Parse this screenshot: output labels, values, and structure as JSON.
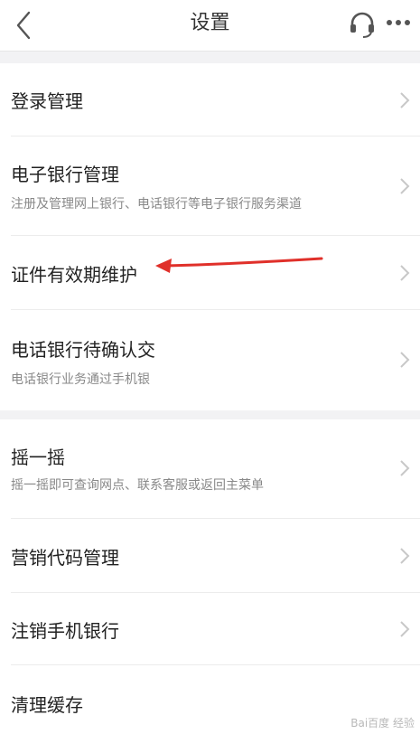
{
  "header": {
    "title": "设置",
    "back_icon": "chevron-left-icon",
    "headset_icon": "headset-icon",
    "more_icon": "more-dots-icon"
  },
  "menu": {
    "login": {
      "title": "登录管理"
    },
    "ebank": {
      "title": "电子银行管理",
      "subtitle": "注册及管理网上银行、电话银行等电子银行服务渠道"
    },
    "cert": {
      "title": "证件有效期维护"
    },
    "phone_pending": {
      "title": "电话银行待确认交",
      "subtitle": "电话银行业务通过手机银"
    },
    "shake": {
      "title": "摇一摇",
      "subtitle": "摇一摇即可查询网点、联系客服或返回主菜单"
    },
    "marketing": {
      "title": "营销代码管理"
    },
    "logout": {
      "title": "注销手机银行"
    },
    "cache": {
      "title": "清理缓存"
    }
  },
  "watermark": "Bai百度 经验",
  "colors": {
    "accent_arrow": "#e0302a",
    "background": "#f2f2f4"
  }
}
